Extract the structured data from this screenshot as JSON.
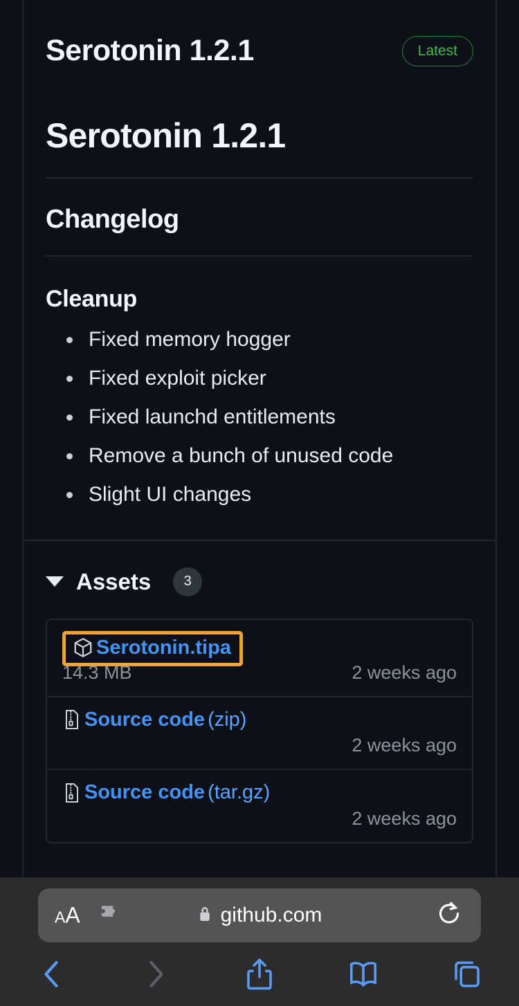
{
  "release": {
    "header_title": "Serotonin 1.2.1",
    "latest_badge": "Latest",
    "h1": "Serotonin 1.2.1",
    "changelog_heading": "Changelog",
    "section_heading": "Cleanup",
    "changes": [
      "Fixed memory hogger",
      "Fixed exploit picker",
      "Fixed launchd entitlements",
      "Remove a bunch of unused code",
      "Slight UI changes"
    ]
  },
  "assets": {
    "label": "Assets",
    "count": "3",
    "rows": [
      {
        "name": "Serotonin.tipa",
        "ext": "",
        "size": "14.3 MB",
        "time": "2 weeks ago",
        "icon": "package-icon",
        "highlighted": true
      },
      {
        "name": "Source code",
        "ext": "(zip)",
        "size": "",
        "time": "2 weeks ago",
        "icon": "file-zip-icon",
        "highlighted": false
      },
      {
        "name": "Source code",
        "ext": "(tar.gz)",
        "size": "",
        "time": "2 weeks ago",
        "icon": "file-zip-icon",
        "highlighted": false
      }
    ]
  },
  "browser": {
    "text_size_small": "A",
    "text_size_large": "A",
    "url": "github.com",
    "icons": {
      "extensions": "puzzle-icon",
      "lock": "lock-icon",
      "reload": "reload-icon",
      "back": "chevron-left-icon",
      "forward": "chevron-right-icon",
      "share": "share-icon",
      "bookmarks": "book-icon",
      "tabs": "tabs-icon"
    }
  },
  "colors": {
    "page_bg": "#0d1117",
    "link": "#4493f8",
    "badge_green": "#3fb950",
    "highlight_orange": "#f0a23c",
    "muted": "#8b949e"
  }
}
